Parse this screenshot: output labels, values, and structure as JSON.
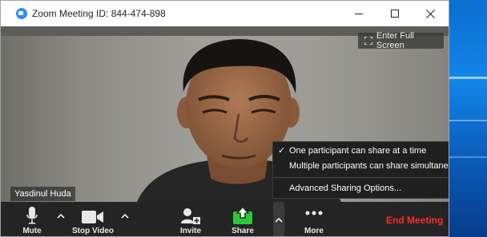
{
  "window": {
    "title": "Zoom Meeting ID: 844-474-898",
    "controls": {
      "minimize": "minimize-icon",
      "maximize": "maximize-icon",
      "close": "close-icon"
    }
  },
  "video": {
    "participant_name": "Yasdinul Huda",
    "fullscreen_label": "Enter Full Screen"
  },
  "share_menu": {
    "items": [
      {
        "label": "One participant can share at a time",
        "checked": true
      },
      {
        "label": "Multiple participants can share simultaneously",
        "checked": false
      },
      {
        "label": "Advanced Sharing Options...",
        "checked": false
      }
    ],
    "check_glyph": "✓"
  },
  "toolbar": {
    "mute_label": "Mute",
    "stop_video_label": "Stop Video",
    "invite_label": "Invite",
    "share_label": "Share",
    "more_label": "More",
    "end_meeting_label": "End Meeting",
    "share_color": "#2dc83a",
    "end_meeting_color": "#ff2b2b",
    "accent": "#2d8cff"
  }
}
